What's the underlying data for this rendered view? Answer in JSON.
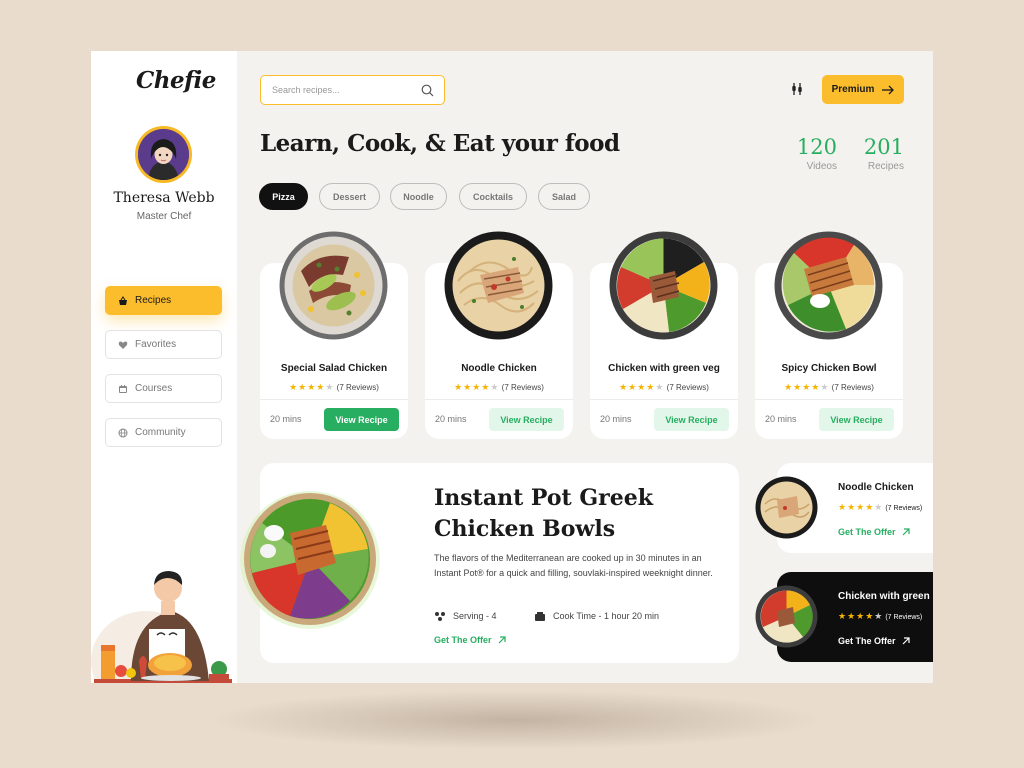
{
  "app": {
    "logo": "Chefie"
  },
  "user": {
    "name": "Theresa Webb",
    "role": "Master Chef"
  },
  "nav": [
    {
      "label": "Recipes",
      "icon": "basket-icon",
      "active": true
    },
    {
      "label": "Favorites",
      "icon": "heart-icon",
      "active": false
    },
    {
      "label": "Courses",
      "icon": "calendar-icon",
      "active": false
    },
    {
      "label": "Community",
      "icon": "globe-icon",
      "active": false
    }
  ],
  "search": {
    "placeholder": "Search recipes..."
  },
  "premium_label": "Premium",
  "headline": "Learn, Cook, & Eat your food",
  "stats": [
    {
      "value": "120",
      "label": "Videos"
    },
    {
      "value": "201",
      "label": "Recipes"
    }
  ],
  "categories": [
    {
      "label": "Pizza",
      "active": true
    },
    {
      "label": "Dessert",
      "active": false
    },
    {
      "label": "Noodle",
      "active": false
    },
    {
      "label": "Cocktails",
      "active": false
    },
    {
      "label": "Salad",
      "active": false
    }
  ],
  "recipes": [
    {
      "title": "Special Salad Chicken",
      "rating": 4,
      "reviews": "(7 Reviews)",
      "time": "20 mins",
      "button": "View Recipe",
      "primary": true
    },
    {
      "title": "Noodle Chicken",
      "rating": 4,
      "reviews": "(7 Reviews)",
      "time": "20 mins",
      "button": "View Recipe",
      "primary": false
    },
    {
      "title": "Chicken with green veg",
      "rating": 4,
      "reviews": "(7 Reviews)",
      "time": "20 mins",
      "button": "View Recipe",
      "primary": false
    },
    {
      "title": "Spicy Chicken Bowl",
      "rating": 4,
      "reviews": "(7 Reviews)",
      "time": "20 mins",
      "button": "View Recipe",
      "primary": false
    }
  ],
  "featured": {
    "title": "Instant Pot Greek Chicken Bowls",
    "description": "The flavors of the Mediterranean are cooked up in 30 minutes in an Instant Pot® for a quick and filling, souvlaki-inspired weeknight dinner.",
    "serving": "Serving - 4",
    "cook_time": "Cook Time - 1 hour 20 min",
    "offer": "Get The Offer"
  },
  "side_offers": [
    {
      "title": "Noodle Chicken",
      "rating": 4,
      "reviews": "(7 Reviews)",
      "offer": "Get The Offer",
      "theme": "light"
    },
    {
      "title": "Chicken with green",
      "rating": 4,
      "reviews": "(7 Reviews)",
      "offer": "Get The Offer",
      "theme": "dark"
    }
  ],
  "colors": {
    "accent": "#fbbd2c",
    "green": "#27ae60",
    "dark": "#0e0e0e",
    "background": "#f4f2ee"
  }
}
